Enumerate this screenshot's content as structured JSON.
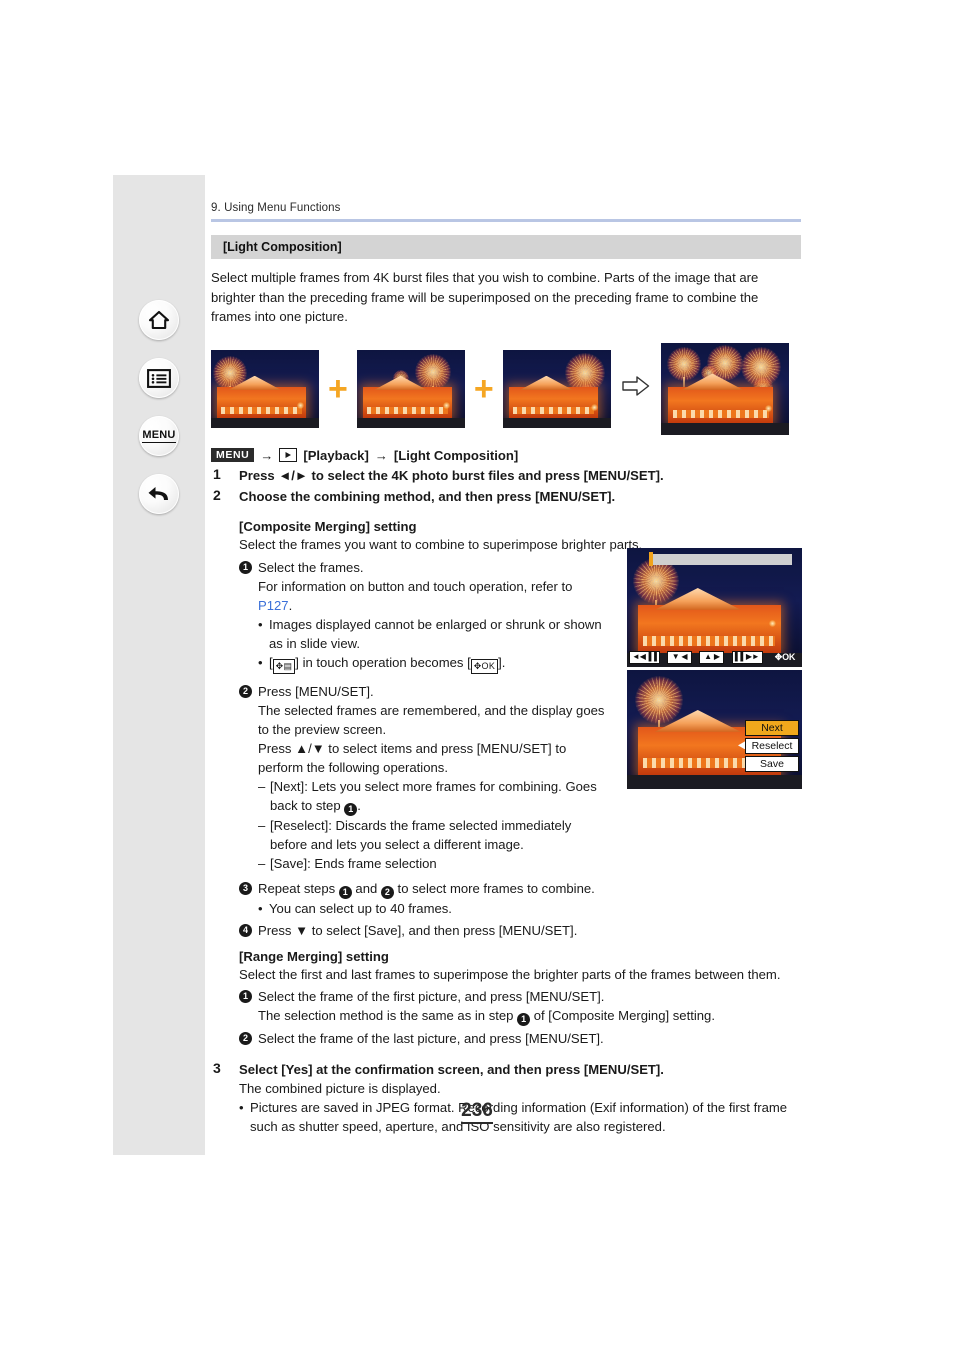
{
  "sidebar": {
    "items": [
      {
        "name": "home-icon",
        "label": "Home"
      },
      {
        "name": "contents-icon",
        "label": "Contents"
      },
      {
        "name": "menu-icon",
        "label": "MENU"
      },
      {
        "name": "back-icon",
        "label": "Back"
      }
    ]
  },
  "header": {
    "chapter": "9. Using Menu Functions",
    "rule_color": "#b9c6e4"
  },
  "section": {
    "title": "[Light Composition]",
    "bar_color": "#d4d4d4"
  },
  "intro": "Select multiple frames from 4K burst files that you wish to combine. Parts of the image that are brighter than the preceding frame will be superimposed on the preceding frame to combine the frames into one picture.",
  "illustration": {
    "plus_color": "#f5a623",
    "plus_symbol": "+",
    "arrow_symbol": "⇨",
    "thumbs": [
      {
        "alt": "fireworks-frame-1"
      },
      {
        "alt": "fireworks-frame-2"
      },
      {
        "alt": "fireworks-frame-3"
      }
    ],
    "result_alt": "combined-fireworks-result"
  },
  "menu_path": {
    "badge": "MENU",
    "arrow": "→",
    "playback_icon": "playback-icon",
    "item1": "[Playback]",
    "item2": "[Light Composition]"
  },
  "steps": [
    {
      "num": "1",
      "text": "Press ◄/► to select the 4K photo burst files and press [MENU/SET]."
    },
    {
      "num": "2",
      "text": "Choose the combining method, and then press [MENU/SET]."
    }
  ],
  "composite": {
    "heading": "[Composite Merging] setting",
    "lead": "Select the frames you want to combine to superimpose brighter parts.",
    "s1": {
      "num": "❶",
      "title": "Select the frames.",
      "line1a": "For information on button and touch operation, refer to",
      "link": "P127",
      "period": ".",
      "bullets": [
        "Images displayed cannot be enlarged or shrunk or shown as in slide view."
      ],
      "touch_line_pre": "[",
      "touch_icon_1": "✥▤",
      "touch_line_mid": "] in touch operation becomes [",
      "touch_icon_2": "✥OK",
      "touch_line_post": "]."
    },
    "s2": {
      "num": "❷",
      "title": "Press [MENU/SET].",
      "line1": "The selected frames are remembered, and the display goes to the preview screen.",
      "line2": "Press ▲/▼ to select items and press [MENU/SET] to perform the following operations.",
      "dashes": [
        {
          "mark": "–",
          "text_pre": "[Next]: Lets you select more frames for combining. Goes back to step ",
          "ref": "❶",
          "text_post": "."
        },
        {
          "mark": "–",
          "text_pre": "[Reselect]: Discards the frame selected immediately before and lets you select a different image.",
          "ref": "",
          "text_post": ""
        },
        {
          "mark": "–",
          "text_pre": "[Save]: Ends frame selection",
          "ref": "",
          "text_post": ""
        }
      ]
    },
    "s3": {
      "num": "❸",
      "text_pre": "Repeat steps ",
      "ref1": "❶",
      "text_mid": " and ",
      "ref2": "❷",
      "text_post": " to select more frames to combine.",
      "bullet": "You can select up to 40 frames."
    },
    "s4": {
      "num": "❹",
      "text": "Press ▼ to select [Save], and then press [MENU/SET]."
    }
  },
  "range": {
    "heading": "[Range Merging] setting",
    "lead": "Select the first and last frames to superimpose the brighter parts of the frames between them.",
    "s1": {
      "num": "❶",
      "title": "Select the frame of the first picture, and press [MENU/SET].",
      "sub_pre": "The selection method is the same as in step ",
      "sub_ref": "❶",
      "sub_post": " of [Composite Merging] setting."
    },
    "s2": {
      "num": "❷",
      "title": "Select the frame of the last picture, and press [MENU/SET]."
    }
  },
  "final_step": {
    "num": "3",
    "title": "Select [Yes] at the confirmation screen, and then press [MENU/SET].",
    "line": "The combined picture is displayed.",
    "bullet": "Pictures are saved in JPEG format. Recording information (Exif information) of the first frame such as shutter speed, aperture, and ISO sensitivity are also registered."
  },
  "camera_screens": {
    "screen1": {
      "name": "frame-selection-screen",
      "controls": [
        {
          "name": "rewind-fast-button",
          "label": "◄◀▐▐"
        },
        {
          "name": "prev-frame-button",
          "label": "▼ ◀"
        },
        {
          "name": "next-frame-button",
          "label": "▲ ▶"
        },
        {
          "name": "forward-fast-button",
          "label": "▌▌▶►"
        },
        {
          "name": "ok-button",
          "label": "✥OK"
        }
      ]
    },
    "screen2": {
      "name": "preview-screen",
      "menu": [
        {
          "label": "Next",
          "selected": true
        },
        {
          "label": "Reselect",
          "selected": false
        },
        {
          "label": "Save",
          "selected": false
        }
      ],
      "highlight_color": "#f0a81c"
    }
  },
  "page_number": "236"
}
